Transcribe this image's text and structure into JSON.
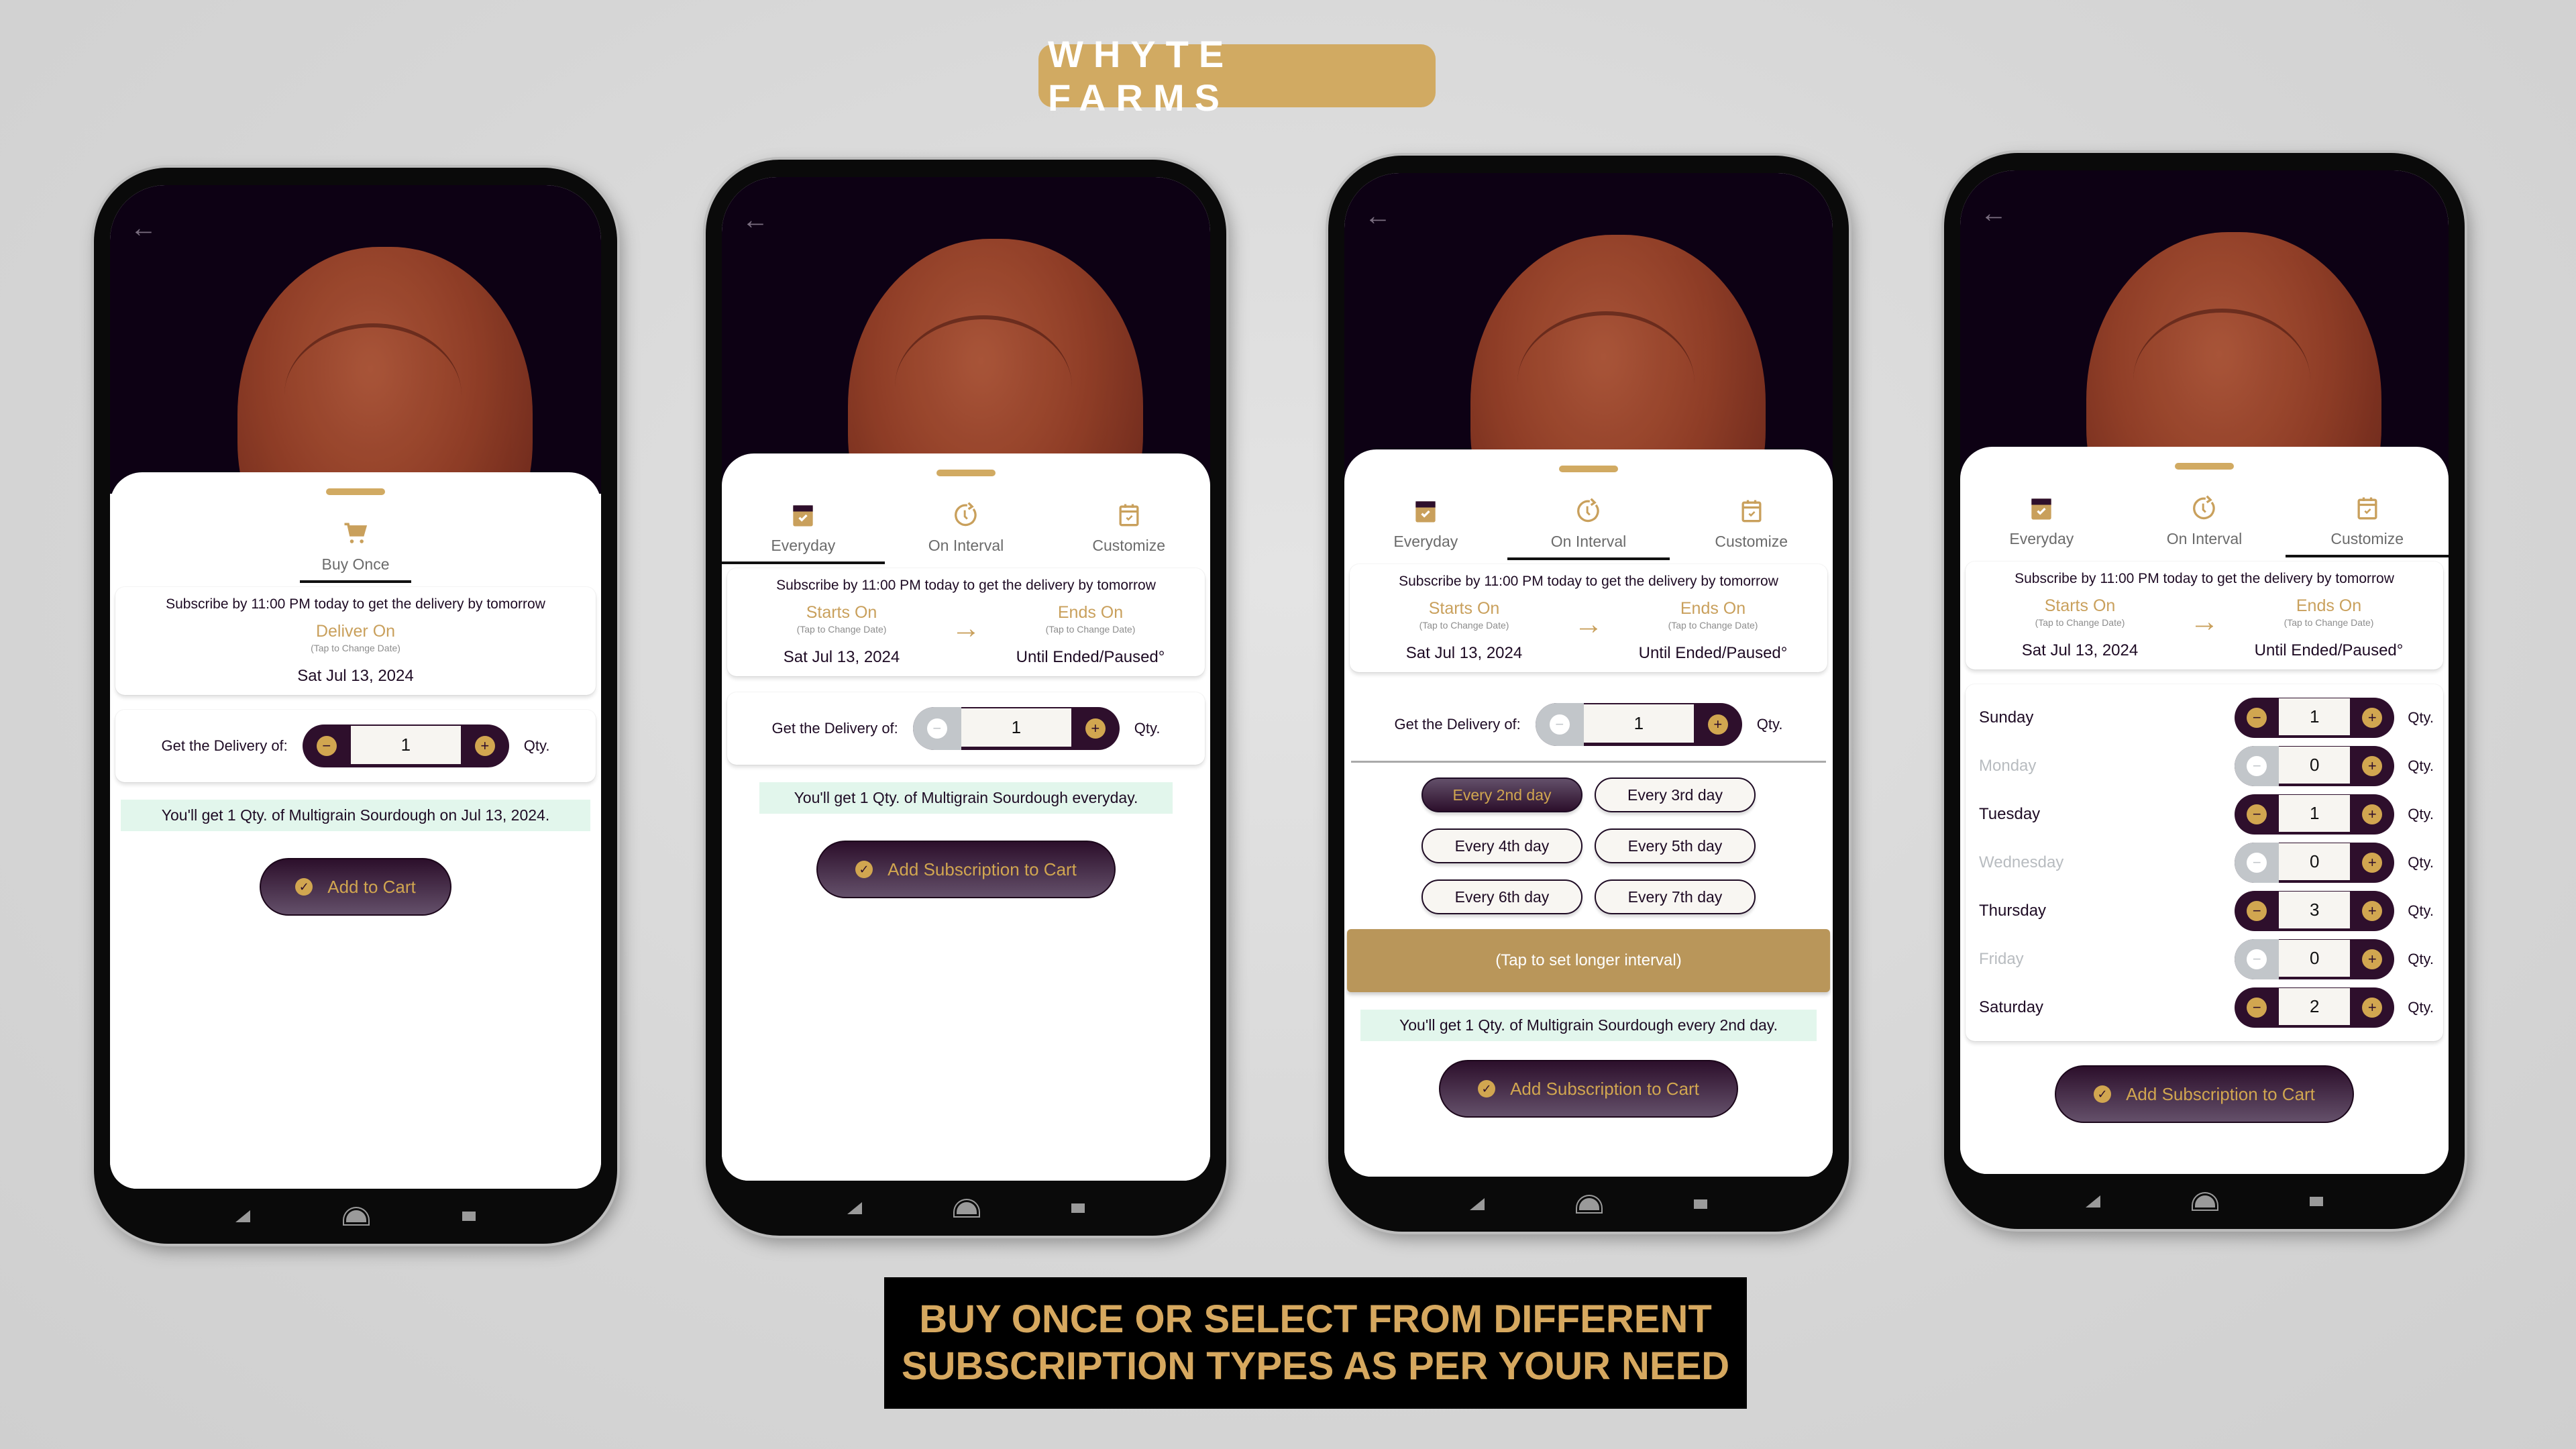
{
  "brand": {
    "title": "WHYTE FARMS",
    "color": "#d1aa62"
  },
  "tagline": {
    "line1": "BUY ONCE OR SELECT FROM DIFFERENT",
    "line2": "SUBSCRIPTION TYPES AS PER YOUR NEED"
  },
  "colors": {
    "accent_gold": "#d1a650",
    "plum": "#2e0f2c",
    "summary_bg": "#e2f6ec",
    "disabled_grey": "#c2c6ca"
  },
  "common": {
    "back_icon": "arrow-left-icon",
    "cutoff": "Subscribe by 11:00 PM today to get the delivery by tomorrow",
    "tap_hint": "(Tap to Change Date)",
    "qty_label": "Get the Delivery of:",
    "qty_unit": "Qty.",
    "minus": "−",
    "plus": "+",
    "check": "✓",
    "arrow": "→"
  },
  "screen1": {
    "tab": {
      "label": "Buy Once",
      "icon": "cart-icon"
    },
    "deliver_on": "Deliver On",
    "date": "Sat Jul 13, 2024",
    "quantity": "1",
    "summary": "You'll get 1 Qty. of Multigrain Sourdough on Jul 13, 2024.",
    "cta": "Add to Cart"
  },
  "subscription_tabs": [
    {
      "label": "Everyday",
      "icon": "calendar-check-icon"
    },
    {
      "label": "On Interval",
      "icon": "clock-refresh-icon"
    },
    {
      "label": "Customize",
      "icon": "calendar-custom-icon"
    }
  ],
  "range": {
    "starts_label": "Starts On",
    "ends_label": "Ends On",
    "start_date": "Sat Jul 13, 2024",
    "end_value": "Until Ended/Paused°"
  },
  "screen2": {
    "active_tab": "Everyday",
    "quantity": "1",
    "summary": "You'll get 1 Qty. of Multigrain Sourdough everyday.",
    "cta": "Add Subscription to Cart"
  },
  "screen3": {
    "active_tab": "On Interval",
    "quantity": "1",
    "intervals": [
      {
        "label": "Every 2nd day",
        "selected": true
      },
      {
        "label": "Every 3rd day",
        "selected": false
      },
      {
        "label": "Every 4th day",
        "selected": false
      },
      {
        "label": "Every 5th day",
        "selected": false
      },
      {
        "label": "Every 6th day",
        "selected": false
      },
      {
        "label": "Every 7th day",
        "selected": false
      }
    ],
    "longer_interval": "(Tap to set longer interval)",
    "summary": "You'll get 1 Qty. of Multigrain Sourdough every 2nd day.",
    "cta": "Add Subscription to Cart"
  },
  "screen4": {
    "active_tab": "Customize",
    "days": [
      {
        "name": "Sunday",
        "qty": "1",
        "active": true
      },
      {
        "name": "Monday",
        "qty": "0",
        "active": false
      },
      {
        "name": "Tuesday",
        "qty": "1",
        "active": true
      },
      {
        "name": "Wednesday",
        "qty": "0",
        "active": false
      },
      {
        "name": "Thursday",
        "qty": "3",
        "active": true
      },
      {
        "name": "Friday",
        "qty": "0",
        "active": false
      },
      {
        "name": "Saturday",
        "qty": "2",
        "active": true
      }
    ],
    "cta": "Add Subscription to Cart"
  }
}
